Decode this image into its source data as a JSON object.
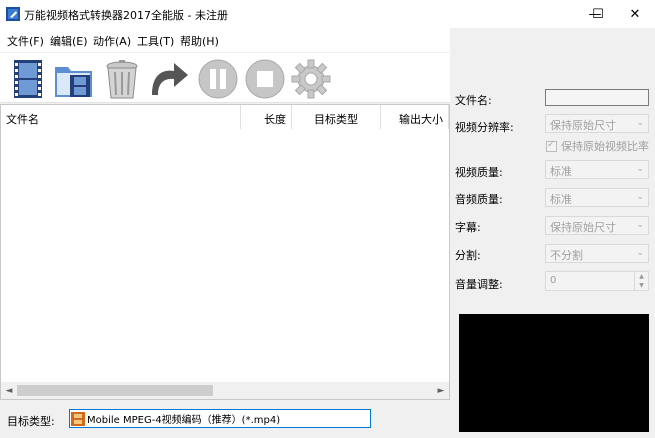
{
  "window": {
    "title": "万能视频格式转换器2017全能版 - 未注册",
    "minimize_glyph": "—",
    "maximize_glyph": "☐",
    "close_glyph": "✕"
  },
  "menu": {
    "items": [
      {
        "label": "文件(F)"
      },
      {
        "label": "编辑(E)"
      },
      {
        "label": "动作(A)"
      },
      {
        "label": "工具(T)"
      },
      {
        "label": "帮助(H)"
      }
    ]
  },
  "toolbar": {
    "tools": [
      {
        "icon": "film-icon"
      },
      {
        "icon": "folder-film-icon"
      },
      {
        "icon": "trash-icon"
      },
      {
        "icon": "redo-icon"
      },
      {
        "icon": "pause-icon"
      },
      {
        "icon": "stop-icon"
      },
      {
        "icon": "gear-icon"
      }
    ]
  },
  "list": {
    "columns": [
      {
        "label": "文件名"
      },
      {
        "label": "长度"
      },
      {
        "label": "目标类型"
      },
      {
        "label": "输出大小"
      }
    ],
    "rows": [],
    "scroll_left": "◄",
    "scroll_right": "►"
  },
  "target": {
    "label": "目标类型:",
    "value": "Mobile MPEG-4视频编码（推荐）(*.mp4)"
  },
  "properties": {
    "filename_label": "文件名:",
    "filename_value": "",
    "resolution_label": "视频分辨率:",
    "resolution_value": "保持原始尺寸",
    "keep_ratio_label": "保持原始视频比率",
    "keep_ratio_checked": true,
    "video_quality_label": "视频质量:",
    "video_quality_value": "标准",
    "audio_quality_label": "音频质量:",
    "audio_quality_value": "标准",
    "subtitle_label": "字幕:",
    "subtitle_value": "保持原始尺寸",
    "split_label": "分割:",
    "split_value": "不分割",
    "volume_label": "音量调整:",
    "volume_value": "0",
    "combo_arrow": "⌄",
    "spin_up": "▲",
    "spin_down": "▼",
    "check_glyph": "✓"
  },
  "colors": {
    "accent": "#0078d7",
    "preview_bg": "#000000",
    "disabled_text": "#a0a0a0"
  }
}
